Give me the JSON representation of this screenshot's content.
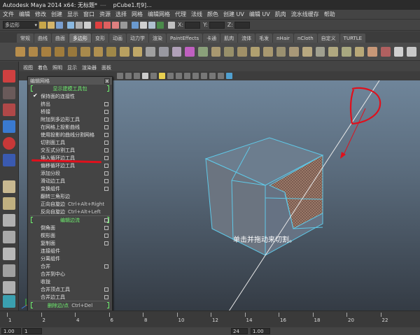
{
  "window": {
    "title": "Autodesk Maya 2014 x64: 无标题*",
    "separator": "---",
    "file": "pCube1.f[9]..."
  },
  "menus": [
    "文件",
    "编辑",
    "修改",
    "创建",
    "显示",
    "窗口",
    "资源",
    "选择",
    "网格",
    "编辑网格",
    "代理",
    "法线",
    "颜色",
    "创建 UV",
    "编辑 UV",
    "肌肉",
    "流水线缓存",
    "帮助"
  ],
  "status": {
    "mode": "多边形",
    "x_label": "X:",
    "y_label": "Y:",
    "z_label": "Z:"
  },
  "shelf_tabs": [
    "常规",
    "曲线",
    "曲面",
    "多边形",
    "变形",
    "动画",
    "动力学",
    "渲染",
    "PaintEffects",
    "卡通",
    "肌肉",
    "流体",
    "毛发",
    "nHair",
    "nCloth",
    "自定义",
    "TURTLE"
  ],
  "shelf_active_index": 3,
  "panel_menus": [
    "视图",
    "着色",
    "照明",
    "显示",
    "渲染器",
    "面板"
  ],
  "popup": {
    "title": "编辑网格",
    "close": "x",
    "items": [
      {
        "type": "section",
        "label": "显示建模工具包"
      },
      {
        "type": "check",
        "label": "保持面的连接性"
      },
      {
        "type": "item",
        "label": "挤出",
        "opt": true
      },
      {
        "type": "item",
        "label": "桥接",
        "opt": true
      },
      {
        "type": "item",
        "label": "附加到多边形工具",
        "opt": true
      },
      {
        "type": "item",
        "label": "在网格上投影曲线",
        "opt": true
      },
      {
        "type": "item",
        "label": "使用投影的曲线分割网格",
        "opt": true
      },
      {
        "type": "item",
        "label": "切割面工具",
        "opt": true
      },
      {
        "type": "item",
        "label": "交互式分割工具",
        "opt": true
      },
      {
        "type": "item",
        "label": "插入循环边工具",
        "opt": true
      },
      {
        "type": "item",
        "label": "偏移循环边工具",
        "opt": true
      },
      {
        "type": "item",
        "label": "添加分段",
        "opt": true
      },
      {
        "type": "item",
        "label": "滑动边工具",
        "opt": true
      },
      {
        "type": "item",
        "label": "变换组件",
        "opt": true
      },
      {
        "type": "item",
        "label": "翻转三角形边",
        "opt": false
      },
      {
        "type": "item",
        "label": "正向自旋边",
        "shortcut": "Ctrl+Alt+Right",
        "opt": false
      },
      {
        "type": "item",
        "label": "反向自旋边",
        "shortcut": "Ctrl+Alt+Left",
        "opt": false
      },
      {
        "type": "section",
        "label": "编辑边流",
        "opt": true
      },
      {
        "type": "item",
        "label": "倒角面",
        "opt": true
      },
      {
        "type": "item",
        "label": "楔形面",
        "opt": true
      },
      {
        "type": "item",
        "label": "复制面",
        "opt": true
      },
      {
        "type": "item",
        "label": "连接组件",
        "opt": false
      },
      {
        "type": "item",
        "label": "分离组件",
        "opt": false
      },
      {
        "type": "item",
        "label": "合并",
        "opt": true
      },
      {
        "type": "item",
        "label": "合并到中心",
        "opt": false
      },
      {
        "type": "item",
        "label": "收拢",
        "opt": false
      },
      {
        "type": "item",
        "label": "合并顶点工具",
        "opt": true
      },
      {
        "type": "item",
        "label": "合并边工具",
        "opt": true
      },
      {
        "type": "section",
        "label": "删除边/点",
        "shortcut": "Ctrl+Del",
        "opt": false
      }
    ]
  },
  "viewport": {
    "hint": "单击并拖动来切割。",
    "annotation_color": "#e0101c",
    "cube_edge_color": "#5fc9e8",
    "selected_face_color": "#8a6a5a"
  },
  "timeline": {
    "ticks": [
      "1",
      "2",
      "4",
      "6",
      "8",
      "10",
      "12",
      "14",
      "16",
      "18",
      "20",
      "22"
    ],
    "current_start": "1.00",
    "current_end": "1.00",
    "range_start": "1",
    "range_end": "24"
  }
}
